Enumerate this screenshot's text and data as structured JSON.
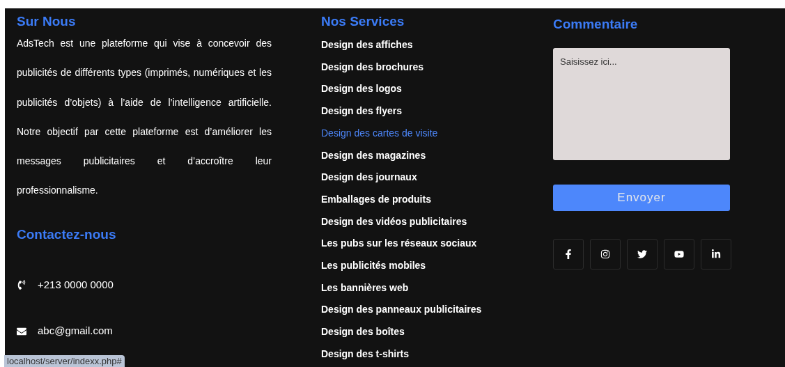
{
  "about": {
    "title": "Sur Nous",
    "text": "AdsTech est une plateforme qui vise à concevoir des publicités de différents types (imprimés, numériques et les publicités d’objets) à l’aide de l’intelligence artificielle. Notre objectif par cette plateforme est d’améliorer les messages publicitaires et d’accroître leur professionnalisme."
  },
  "contact": {
    "title": "Contactez-nous",
    "phone": "+213 0000 0000",
    "email": "abc@gmail.com"
  },
  "services": {
    "title": "Nos Services",
    "items": [
      {
        "label": "Design des affiches",
        "selected": false
      },
      {
        "label": "Design des brochures",
        "selected": false
      },
      {
        "label": "Design des logos",
        "selected": false
      },
      {
        "label": "Design des flyers",
        "selected": false
      },
      {
        "label": "Design des cartes de visite",
        "selected": true
      },
      {
        "label": "Design des magazines",
        "selected": false
      },
      {
        "label": "Design des journaux",
        "selected": false
      },
      {
        "label": "Emballages de produits",
        "selected": false
      },
      {
        "label": "Design des vidéos publicitaires",
        "selected": false
      },
      {
        "label": "Les pubs sur les réseaux sociaux",
        "selected": false
      },
      {
        "label": "Les publicités mobiles",
        "selected": false
      },
      {
        "label": "Les bannières web",
        "selected": false
      },
      {
        "label": "Design des panneaux publicitaires",
        "selected": false
      },
      {
        "label": "Design des boîtes",
        "selected": false
      },
      {
        "label": "Design des t-shirts",
        "selected": false
      }
    ]
  },
  "comment": {
    "title": "Commentaire",
    "placeholder": "Saisissez ici...",
    "button": "Envoyer"
  },
  "status_bar": {
    "url": "localhost/server/indexx.php#"
  }
}
